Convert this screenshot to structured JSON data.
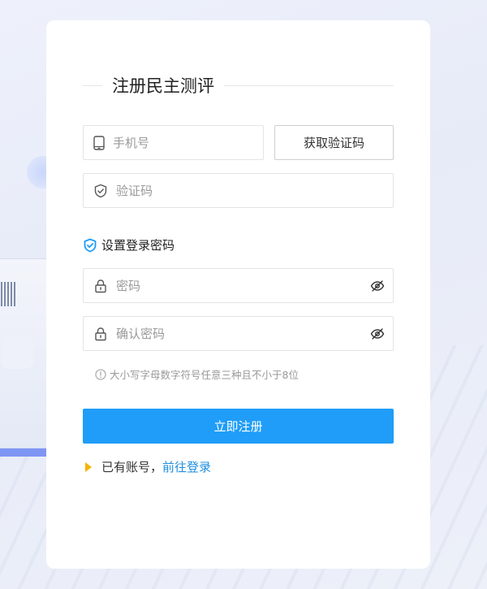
{
  "title": "注册民主测评",
  "phone": {
    "placeholder": "手机号",
    "value": ""
  },
  "get_code_button": "获取验证码",
  "code": {
    "placeholder": "验证码",
    "value": ""
  },
  "password_section_label": "设置登录密码",
  "password": {
    "placeholder": "密码",
    "value": ""
  },
  "confirm_password": {
    "placeholder": "确认密码",
    "value": ""
  },
  "password_hint": "大小写字母数字符号任意三种且不小于8位",
  "submit_button": "立即注册",
  "login_prompt": {
    "text": "已有账号，",
    "link": "前往登录"
  },
  "colors": {
    "primary": "#1f9df8",
    "link": "#1f8fe0",
    "arrow": "#f5b400",
    "shield": "#1f9df8"
  },
  "icons": [
    "phone-icon",
    "shield-icon",
    "shield-check-icon",
    "lock-icon",
    "eye-off-icon",
    "info-icon",
    "triangle-right-icon"
  ]
}
